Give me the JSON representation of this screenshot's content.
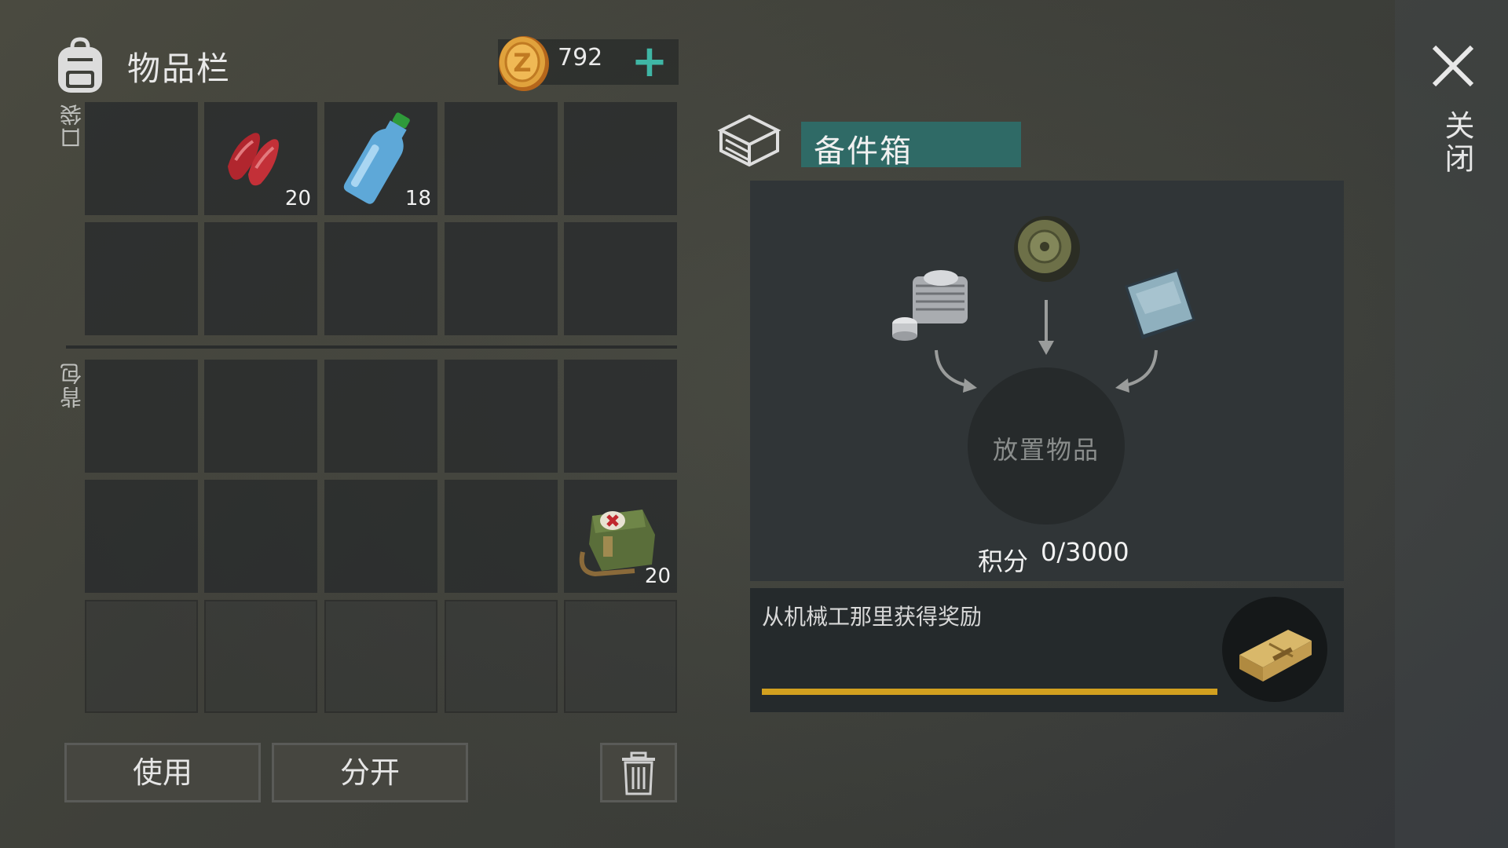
{
  "header": {
    "title": "物品栏",
    "bag_icon": "backpack-icon"
  },
  "currency": {
    "value": "792",
    "add_label": "+",
    "icon": "coin-icon",
    "accent": "#3fb6a5"
  },
  "sections": {
    "pocket_label": "口袋",
    "backpack_label": "背包"
  },
  "pocket": {
    "slots": [
      {
        "item": null
      },
      {
        "item": "raw-meat",
        "count": "20"
      },
      {
        "item": "water-bottle",
        "count": "18"
      },
      {
        "item": null
      },
      {
        "item": null
      },
      {
        "item": null
      },
      {
        "item": null
      },
      {
        "item": null
      },
      {
        "item": null
      },
      {
        "item": null
      }
    ]
  },
  "backpack": {
    "slots": [
      {
        "item": null
      },
      {
        "item": null
      },
      {
        "item": null
      },
      {
        "item": null
      },
      {
        "item": null
      },
      {
        "item": null
      },
      {
        "item": null
      },
      {
        "item": null
      },
      {
        "item": null
      },
      {
        "item": "first-aid-bag",
        "count": "20"
      },
      {
        "item": null,
        "locked": true
      },
      {
        "item": null,
        "locked": true
      },
      {
        "item": null,
        "locked": true
      },
      {
        "item": null,
        "locked": true
      },
      {
        "item": null,
        "locked": true
      }
    ]
  },
  "buttons": {
    "use": "使用",
    "split": "分开",
    "trash_icon": "trash-icon"
  },
  "parts_box": {
    "title": "备件箱",
    "drop_text": "放置物品",
    "score_label": "积分",
    "score_value": "0/3000",
    "ingredients": [
      "engine-cylinder-icon",
      "wheel-icon",
      "metal-plate-icon"
    ]
  },
  "reward": {
    "text": "从机械工那里获得奖励",
    "progress": 1.0,
    "bar_color": "#d2a01f",
    "icon": "weapon-crate-icon"
  },
  "close": {
    "label": "关闭"
  }
}
